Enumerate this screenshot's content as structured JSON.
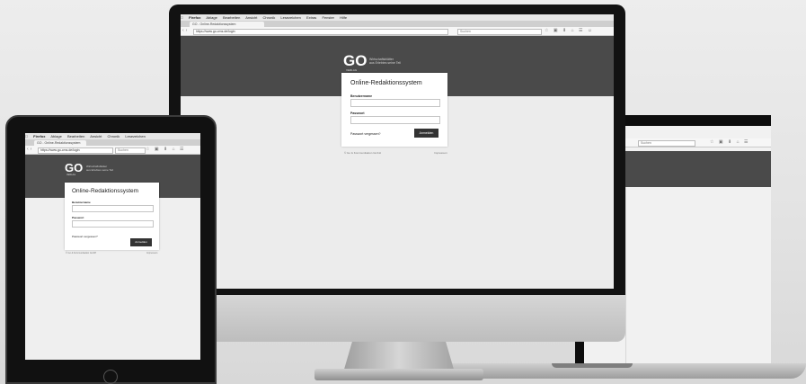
{
  "browser": {
    "app_name": "Firefox",
    "menu": [
      "Ablage",
      "Bearbeiten",
      "Ansicht",
      "Chronik",
      "Lesezeichen",
      "Extras",
      "Fenster",
      "Hilfe"
    ],
    "tab_title": "GO - Online-Redaktionssystem",
    "url": "https://www.go-cms.de/login",
    "search_placeholder": "Suchen"
  },
  "site": {
    "logo": "GO",
    "logo_sub": "VERLAG",
    "tagline_line1": "Wirtschaftsblätter",
    "tagline_line2": "aus Erlebtes seine Teil",
    "colors": {
      "header": "#4a4a4a",
      "button": "#333333"
    }
  },
  "login": {
    "title": "Online-Redaktionssystem",
    "username_label": "Benutzername",
    "password_label": "Passwort",
    "forgot_label": "Passwort vergessen?",
    "submit_label": "Anmelden",
    "footer_left": "© Go & Kommunikation GmbH",
    "footer_right": "Impressum"
  }
}
